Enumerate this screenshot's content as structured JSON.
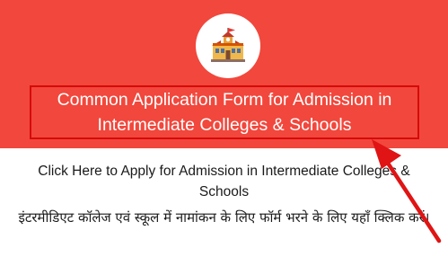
{
  "header": {
    "logo_icon": "school-building-icon",
    "title": "Common Application Form for Admission in Intermediate Colleges & Schools",
    "background_color": "#f2473c",
    "highlight_color": "#d60a0a"
  },
  "body": {
    "link_en": "Click Here to Apply for Admission in Intermediate Colleges & Schools",
    "link_hi": "इंटरमीडिएट कॉलेज एवं स्कूल में नामांकन के लिए फॉर्म भरने के लिए यहाँ क्लिक करें।"
  },
  "annotation": {
    "arrow_icon": "red-pointer-arrow-icon",
    "arrow_color": "#e01414"
  }
}
